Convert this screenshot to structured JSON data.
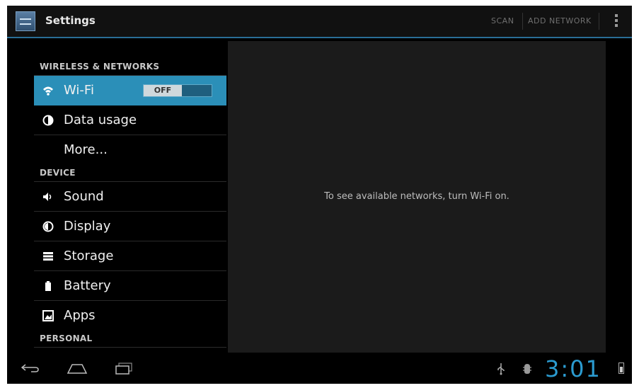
{
  "action_bar": {
    "title": "Settings",
    "actions": [
      "SCAN",
      "ADD NETWORK"
    ]
  },
  "settings": {
    "wireless_header": "WIRELESS & NETWORKS",
    "wifi_label": "Wi-Fi",
    "wifi_toggle": "OFF",
    "data_usage_label": "Data usage",
    "more_label": "More...",
    "device_header": "DEVICE",
    "sound_label": "Sound",
    "display_label": "Display",
    "storage_label": "Storage",
    "battery_label": "Battery",
    "apps_label": "Apps",
    "personal_header": "PERSONAL"
  },
  "detail": {
    "message": "To see available networks, turn Wi-Fi on."
  },
  "status": {
    "time": "3:01"
  },
  "colors": {
    "accent": "#2b8fb8",
    "clock": "#2b9bd0"
  }
}
